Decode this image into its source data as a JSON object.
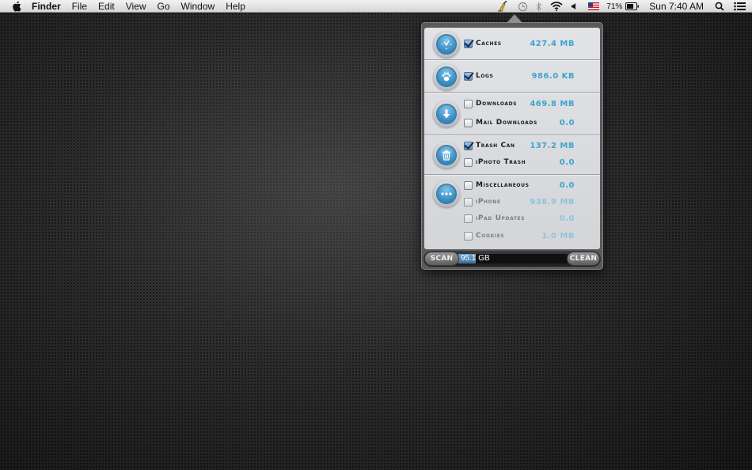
{
  "menubar": {
    "app_name": "Finder",
    "menus": [
      "File",
      "Edit",
      "View",
      "Go",
      "Window",
      "Help"
    ],
    "battery_percent": "71%",
    "clock": "Sun 7:40 AM"
  },
  "popover": {
    "groups": [
      {
        "icon": "clock-icon",
        "items": [
          {
            "label": "Caches",
            "size": "427.4 MB",
            "checked": true,
            "dim": false
          }
        ]
      },
      {
        "icon": "paw-icon",
        "items": [
          {
            "label": "Logs",
            "size": "986.0 KB",
            "checked": true,
            "dim": false
          }
        ]
      },
      {
        "icon": "download-arrow-icon",
        "items": [
          {
            "label": "Downloads",
            "size": "469.8 MB",
            "checked": false,
            "dim": false
          },
          {
            "label": "Mail Downloads",
            "size": "0.0",
            "checked": false,
            "dim": false
          }
        ]
      },
      {
        "icon": "trash-icon",
        "items": [
          {
            "label": "Trash Can",
            "size": "137.2 MB",
            "checked": true,
            "dim": false
          },
          {
            "label": "iPhoto Trash",
            "size": "0.0",
            "checked": false,
            "dim": false
          }
        ]
      },
      {
        "icon": "ellipsis-icon",
        "items": [
          {
            "label": "Miscellaneous",
            "size": "0.0",
            "checked": false,
            "dim": false
          },
          {
            "label": "iPhone",
            "size": "938.9 MB",
            "checked": false,
            "dim": true
          },
          {
            "label": "iPad Updates",
            "size": "0.0",
            "checked": false,
            "dim": true
          },
          {
            "label": "Cookies",
            "size": "1.0 MB",
            "checked": false,
            "dim": true
          }
        ]
      }
    ],
    "bottom": {
      "scan_label": "SCAN",
      "clean_label": "CLEAN",
      "total_value": "95.1",
      "total_unit": "GB",
      "fill_fraction": 0.16
    }
  }
}
